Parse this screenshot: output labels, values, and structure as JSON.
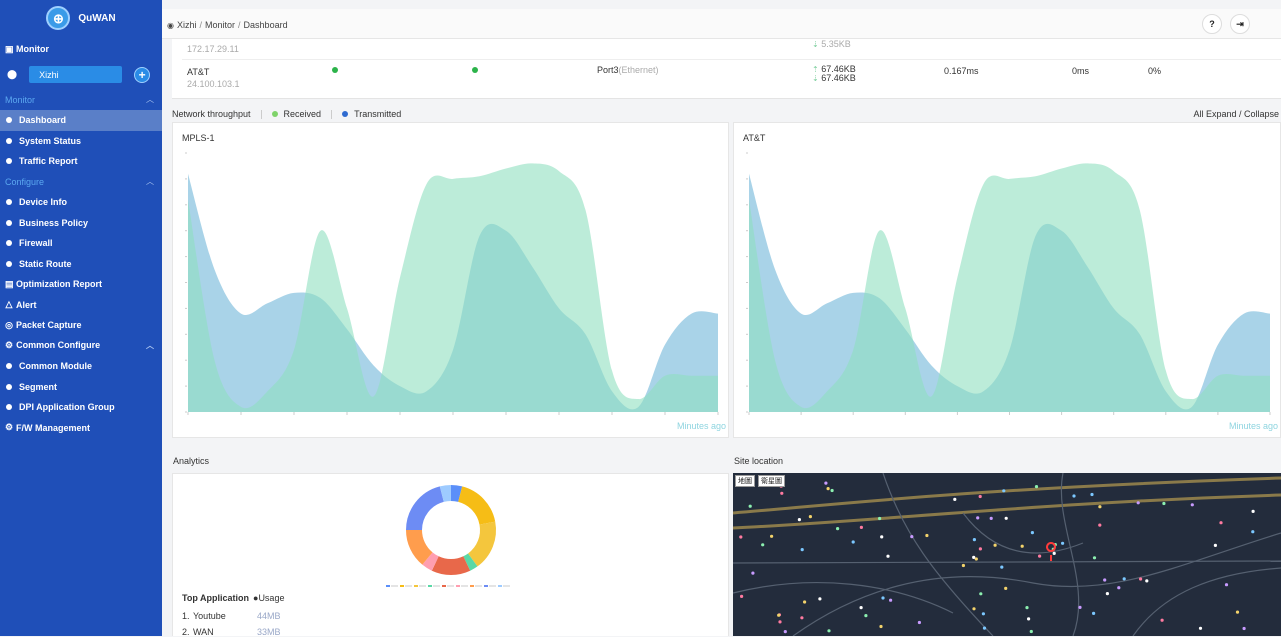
{
  "app": {
    "name": "QuWAN"
  },
  "sidebar": {
    "monitor_header": "Monitor",
    "site": "Xizhi",
    "sections": [
      {
        "label": "Monitor",
        "items": [
          "Dashboard",
          "System Status",
          "Traffic Report"
        ]
      },
      {
        "label": "Configure",
        "items": [
          "Device Info",
          "Business Policy",
          "Firewall",
          "Static Route"
        ]
      }
    ],
    "top_items": [
      "Optimization Report",
      "Alert",
      "Packet Capture"
    ],
    "common_configure": {
      "label": "Common Configure",
      "items": [
        "Common Module",
        "Segment",
        "DPI Application Group"
      ]
    },
    "fw": "F/W Management"
  },
  "breadcrumb": [
    "Xizhi",
    "Monitor",
    "Dashboard"
  ],
  "wan_table": {
    "row0": {
      "ip": "172.17.29.11",
      "rx": "5.35KB"
    },
    "row1": {
      "name": "AT&T",
      "ip": "24.100.103.1",
      "port": "Port3",
      "port_type": "(Ethernet)",
      "tx": "67.46KB",
      "rx": "67.46KB",
      "latency": "0.167ms",
      "jitter": "0ms",
      "loss": "0%"
    }
  },
  "throughput": {
    "label": "Network throughput",
    "received": "Received",
    "transmitted": "Transmitted",
    "expand": "All Expand / Collapse",
    "colors": {
      "received": "#8fe0c0",
      "transmitted": "#6fb6d8"
    }
  },
  "chart_data": [
    {
      "type": "area",
      "title": "MPLS-1",
      "xlabel": "Minutes ago",
      "x": [
        0,
        1,
        2,
        3,
        4,
        5,
        6,
        7,
        8,
        9,
        10,
        11,
        12,
        13,
        14,
        15,
        16,
        17,
        18,
        19,
        20
      ],
      "series": [
        {
          "name": "Received",
          "values": [
            82,
            20,
            2,
            8,
            24,
            70,
            40,
            6,
            52,
            88,
            90,
            91,
            94,
            96,
            93,
            78,
            16,
            5,
            14,
            14,
            14
          ]
        },
        {
          "name": "Transmitted",
          "values": [
            92,
            55,
            38,
            42,
            46,
            44,
            32,
            18,
            10,
            8,
            24,
            68,
            70,
            56,
            40,
            30,
            8,
            2,
            26,
            38,
            38
          ]
        }
      ],
      "ylim": [
        0,
        100
      ]
    },
    {
      "type": "area",
      "title": "AT&T",
      "xlabel": "Minutes ago",
      "x": [
        0,
        1,
        2,
        3,
        4,
        5,
        6,
        7,
        8,
        9,
        10,
        11,
        12,
        13,
        14,
        15,
        16,
        17,
        18,
        19,
        20
      ],
      "series": [
        {
          "name": "Received",
          "values": [
            82,
            20,
            2,
            8,
            24,
            70,
            40,
            6,
            52,
            88,
            90,
            91,
            94,
            96,
            93,
            78,
            16,
            5,
            14,
            14,
            14
          ]
        },
        {
          "name": "Transmitted",
          "values": [
            92,
            55,
            38,
            42,
            46,
            44,
            32,
            18,
            10,
            8,
            24,
            68,
            70,
            56,
            40,
            30,
            8,
            2,
            26,
            38,
            38
          ]
        }
      ],
      "ylim": [
        0,
        100
      ]
    }
  ],
  "analytics": {
    "title": "Analytics",
    "donut": [
      {
        "value": 4,
        "color": "#5b8ff9"
      },
      {
        "value": 18,
        "color": "#f6bd16"
      },
      {
        "value": 18,
        "color": "#f4c63d"
      },
      {
        "value": 3,
        "color": "#5ad8a6"
      },
      {
        "value": 14,
        "color": "#e8684a"
      },
      {
        "value": 4,
        "color": "#ff9eb0"
      },
      {
        "value": 14,
        "color": "#ff9d4d"
      },
      {
        "value": 21,
        "color": "#6d8cf4"
      },
      {
        "value": 4,
        "color": "#9ecbff"
      }
    ],
    "top_app_label": "Top Application",
    "usage_label": "Usage",
    "apps": [
      {
        "rank": "1.",
        "name": "Youtube",
        "value": "44MB"
      },
      {
        "rank": "2.",
        "name": "WAN",
        "value": "33MB"
      }
    ]
  },
  "site_location": {
    "title": "Site location",
    "tabs": [
      "地圖",
      "衛星圖"
    ]
  }
}
